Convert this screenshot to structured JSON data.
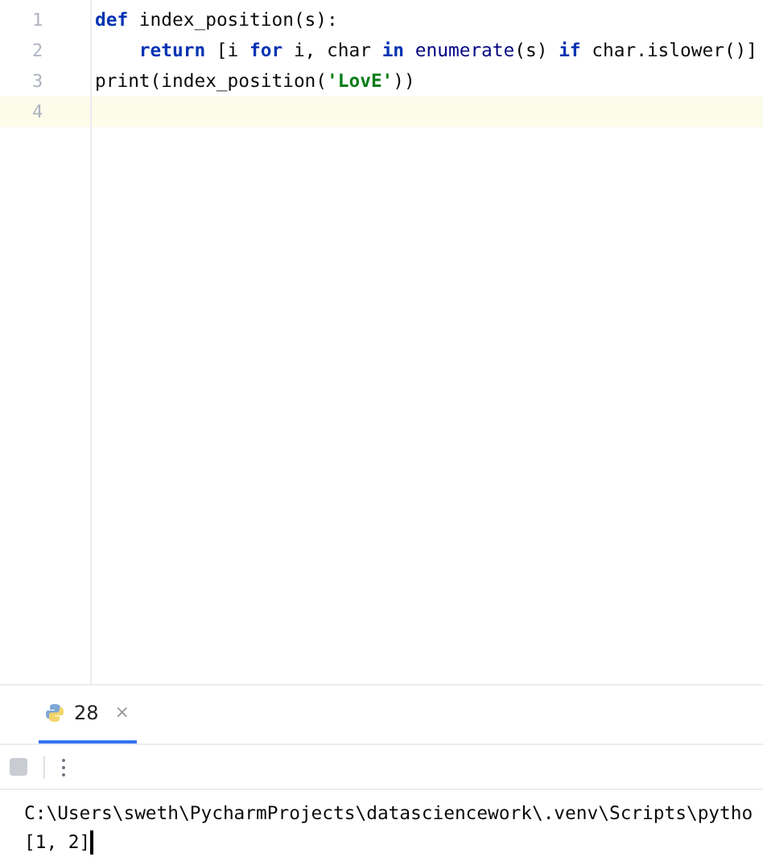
{
  "editor": {
    "lines": [
      {
        "number": "1",
        "current": false,
        "tokens": [
          {
            "kind": "keyword",
            "text": "def"
          },
          {
            "kind": "plain",
            "text": " index_position(s):"
          }
        ]
      },
      {
        "number": "2",
        "current": false,
        "tokens": [
          {
            "kind": "keyword",
            "text": "    return"
          },
          {
            "kind": "plain",
            "text": " [i "
          },
          {
            "kind": "keyword",
            "text": "for"
          },
          {
            "kind": "plain",
            "text": " i, char "
          },
          {
            "kind": "keyword",
            "text": "in "
          },
          {
            "kind": "builtin",
            "text": "enumerate"
          },
          {
            "kind": "plain",
            "text": "(s) "
          },
          {
            "kind": "keyword",
            "text": "if"
          },
          {
            "kind": "plain",
            "text": " char.islower()]"
          }
        ]
      },
      {
        "number": "3",
        "current": false,
        "tokens": [
          {
            "kind": "plain",
            "text": "print(index_position("
          },
          {
            "kind": "string",
            "text": "'LovE'"
          },
          {
            "kind": "plain",
            "text": "))"
          }
        ]
      },
      {
        "number": "4",
        "current": true
      }
    ]
  },
  "run_panel": {
    "tabs": [
      {
        "label": "28",
        "selected": true,
        "close": "×"
      }
    ],
    "output": [
      "C:\\Users\\sweth\\PycharmProjects\\datasciencework\\.venv\\Scripts\\pytho",
      "[1, 2]"
    ]
  }
}
